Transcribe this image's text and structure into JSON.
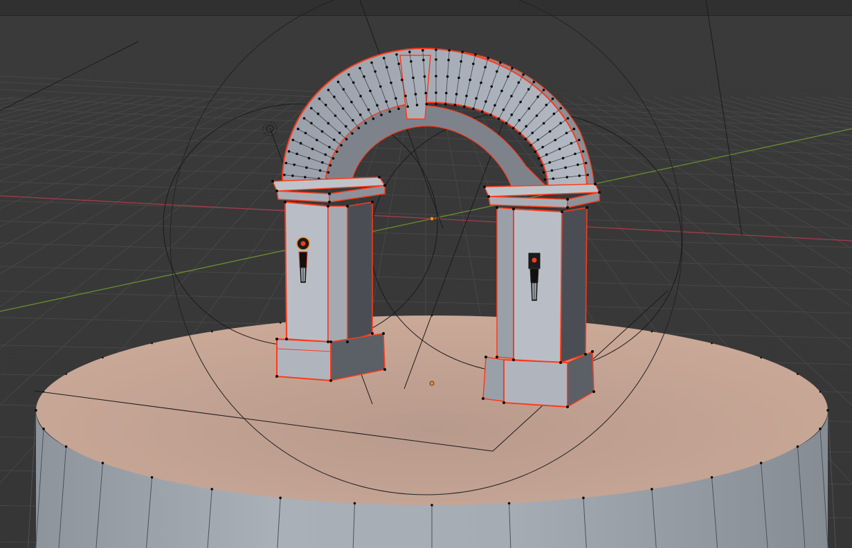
{
  "viewport": {
    "view_mode": "edit-mode-3d-viewport",
    "colors": {
      "background": "#3a3a3a",
      "header": "#303030",
      "grid": "#474747",
      "axis_x": "#a33b4b",
      "axis_y": "#6b8f2f",
      "selected_edge": "#ff3a1a",
      "active_face": "#c9a696",
      "mesh_face": "#a3a9b2",
      "vertex": "#0a0a0a",
      "origin": "#ff8c1a"
    }
  },
  "objects": [
    {
      "name": "arch",
      "icon": "mesh-object-icon",
      "selected": true
    },
    {
      "name": "left-pillar",
      "icon": "mesh-object-icon",
      "selected": true
    },
    {
      "name": "right-pillar",
      "icon": "mesh-object-icon",
      "selected": true
    },
    {
      "name": "left-torch",
      "icon": "torch-icon",
      "selected": true
    },
    {
      "name": "right-torch",
      "icon": "torch-icon",
      "selected": true
    },
    {
      "name": "cylinder-platform",
      "icon": "mesh-object-icon",
      "selected": false
    },
    {
      "name": "point-light",
      "icon": "light-icon",
      "selected": false
    }
  ]
}
